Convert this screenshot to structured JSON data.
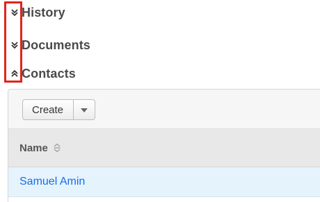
{
  "panels": [
    {
      "title": "History",
      "state": "collapsed",
      "icon": "chevron-double-down-icon"
    },
    {
      "title": "Documents",
      "state": "collapsed",
      "icon": "chevron-double-down-icon"
    },
    {
      "title": "Contacts",
      "state": "expanded",
      "icon": "chevron-double-up-icon"
    }
  ],
  "highlight": {
    "color": "#e2231a"
  },
  "contacts": {
    "toolbar": {
      "create_label": "Create",
      "dropdown_icon": "caret-down-icon"
    },
    "table": {
      "columns": [
        {
          "label": "Name",
          "sort_icon": "sort-icon"
        }
      ],
      "rows": [
        {
          "name": "Samuel Amin"
        }
      ]
    }
  },
  "colors": {
    "link": "#176de5",
    "row_highlight": "#e5f3fd",
    "header_bg": "#e8e8e8"
  }
}
